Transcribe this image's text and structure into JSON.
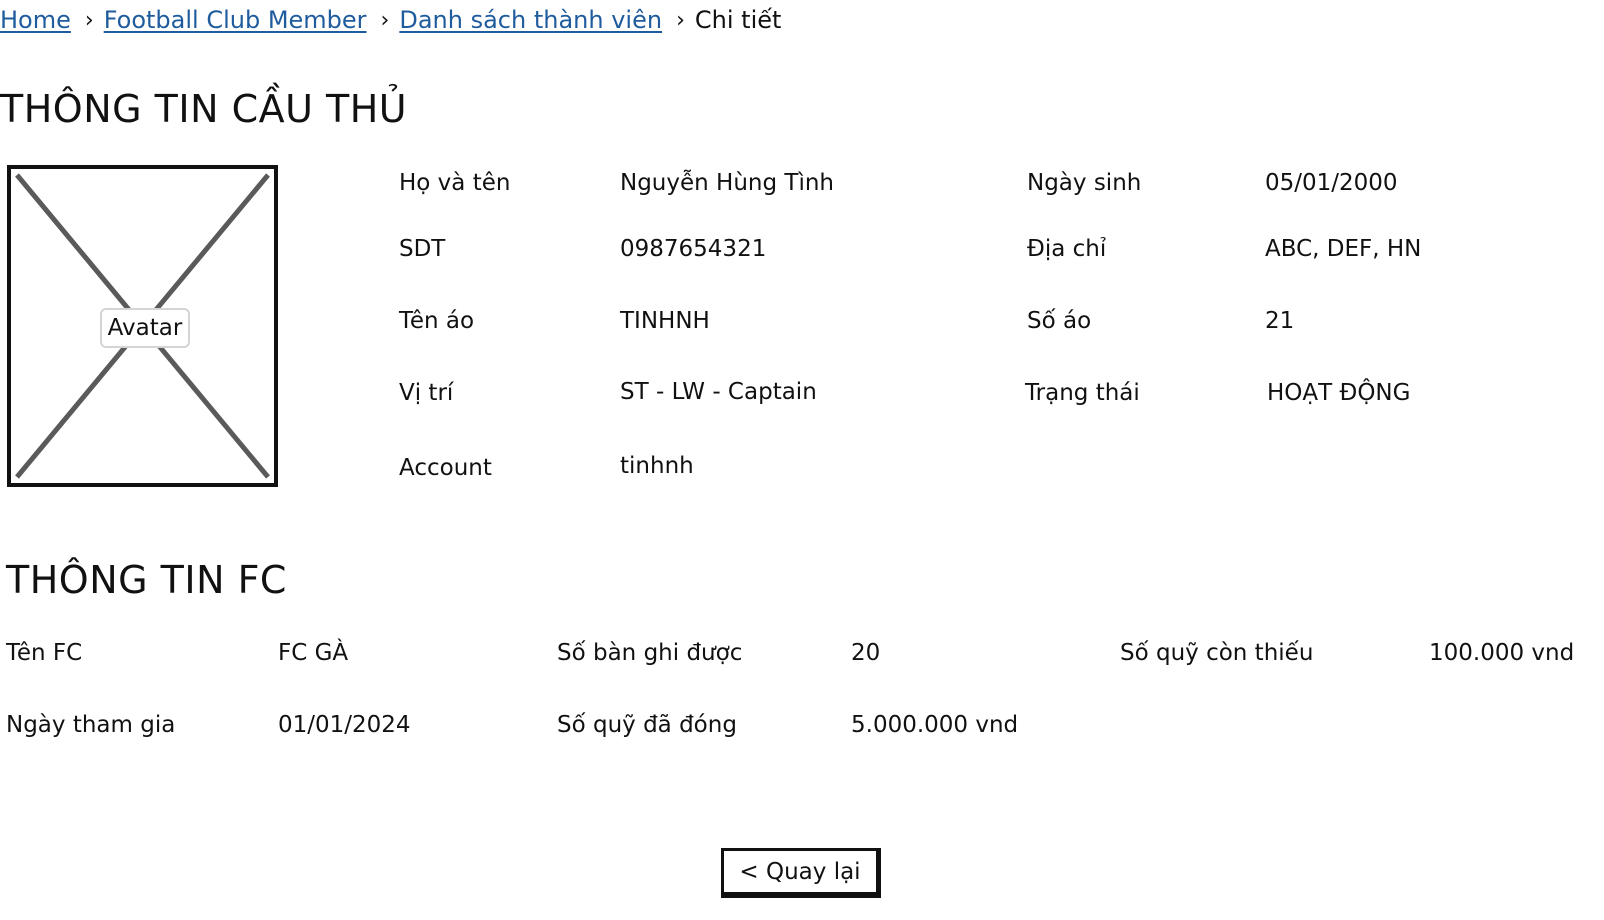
{
  "breadcrumb": {
    "home": "Home",
    "club": "Football Club Member",
    "list": "Danh sách thành viên",
    "current": "Chi tiết",
    "separator": "›"
  },
  "player_section": {
    "title": "THÔNG TIN CẦU THỦ",
    "avatar_label": "Avatar",
    "full_name_label": "Họ và tên",
    "full_name": "Nguyễn Hùng Tình",
    "birthday_label": "Ngày sinh",
    "birthday": "05/01/2000",
    "phone_label": "SDT",
    "phone": "0987654321",
    "address_label": "Địa chỉ",
    "address": "ABC, DEF, HN",
    "shirt_name_label": "Tên áo",
    "shirt_name": "TINHNH",
    "shirt_number_label": "Số áo",
    "shirt_number": "21",
    "position_label": "Vị trí",
    "position": "ST - LW - Captain",
    "status_label": "Trạng thái",
    "status": "HOẠT ĐỘNG",
    "account_label": "Account",
    "account": "tinhnh"
  },
  "fc_section": {
    "title": "THÔNG TIN FC",
    "fc_name_label": "Tên FC",
    "fc_name": "FC GÀ",
    "goals_label": "Số bàn ghi được",
    "goals": "20",
    "fund_owed_label": "Số quỹ còn thiếu",
    "fund_owed": "100.000 vnd",
    "join_date_label": "Ngày tham gia",
    "join_date": "01/01/2024",
    "fund_paid_label": "Số quỹ đã đóng",
    "fund_paid": "5.000.000 vnd"
  },
  "back_button": "< Quay lại"
}
